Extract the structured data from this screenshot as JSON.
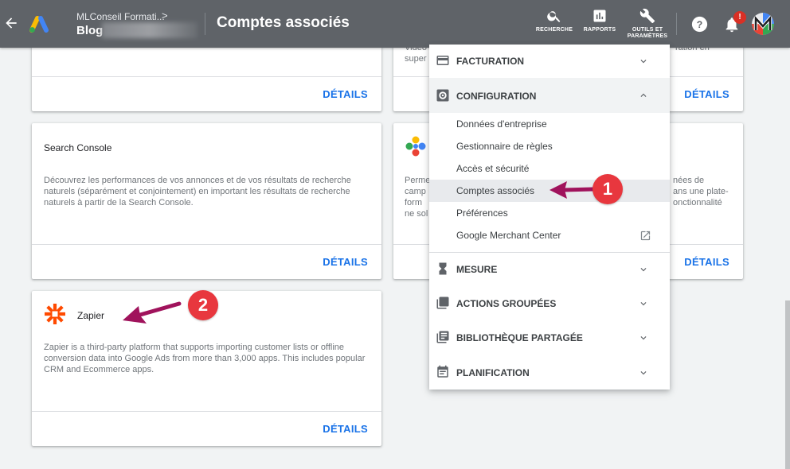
{
  "header": {
    "account_name": "MLConseil Formati...",
    "account_chevron": ">",
    "account_sub": "Blog",
    "title": "Comptes associés",
    "tools": [
      {
        "label": "RECHERCHE",
        "icon": "search-icon"
      },
      {
        "label": "RAPPORTS",
        "icon": "reports-icon"
      },
      {
        "label_line1": "OUTILS ET",
        "label_line2": "PARAMÈTRES",
        "icon": "wrench-icon"
      }
    ],
    "notification_count": "!"
  },
  "cards": {
    "top_left": {
      "details": "DÉTAILS"
    },
    "top_right": {
      "snippet": [
        "Vidéo",
        "super"
      ],
      "snippet_right": "ration en",
      "details": "DÉTAILS"
    },
    "search_console": {
      "title": "Search Console",
      "description": "Découvrez les performances de vos annonces et de vos résultats de recherche naturels (séparément et conjointement) en important les résultats de recherche naturels à partir de la Search Console.",
      "details": "DÉTAILS"
    },
    "middle_right": {
      "left_lines": [
        "Perme",
        "camp",
        "form",
        "ne sol"
      ],
      "right_lines": [
        "nées de",
        "ans une plate-",
        "onctionnalité"
      ],
      "details": "DÉTAILS"
    },
    "zapier": {
      "title": "Zapier",
      "description": "Zapier is a third-party platform that supports importing customer lists or offline conversion data into Google Ads from more than 3,000 apps. This includes popular CRM and Ecommerce apps.",
      "details": "DÉTAILS"
    }
  },
  "menu": {
    "billing": "FACTURATION",
    "setup": "CONFIGURATION",
    "setup_items": [
      "Données d'entreprise",
      "Gestionnaire de règles",
      "Accès et sécurité",
      "Comptes associés",
      "Préférences",
      "Google Merchant Center"
    ],
    "measurement": "MESURE",
    "bulk_actions": "ACTIONS GROUPÉES",
    "shared_library": "BIBLIOTHÈQUE PARTAGÉE",
    "planning": "PLANIFICATION"
  },
  "annotations": {
    "step1": "1",
    "step2": "2"
  },
  "colors": {
    "header_bg": "#5f6368",
    "accent": "#1a73e8",
    "annotation_red": "#e8373e",
    "arrow": "#a0135c",
    "zapier": "#ff4a00"
  }
}
